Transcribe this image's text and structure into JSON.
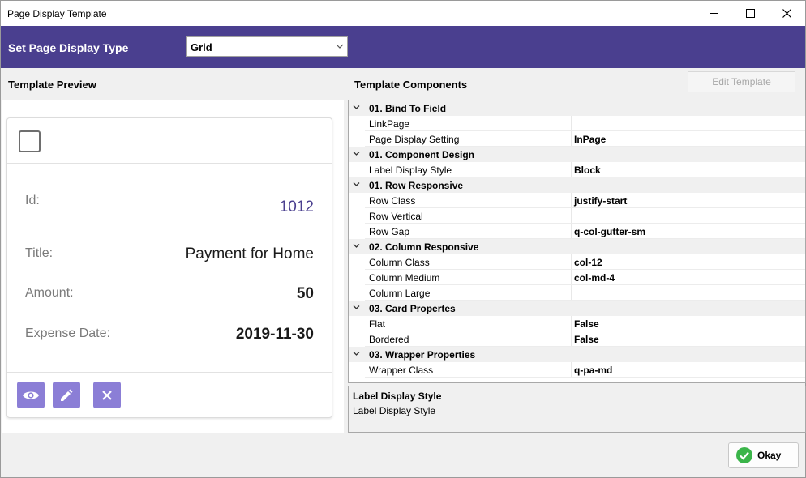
{
  "window": {
    "title": "Page Display Template"
  },
  "header": {
    "label": "Set Page Display Type",
    "select_value": "Grid"
  },
  "preview": {
    "title": "Template Preview",
    "fields": [
      {
        "label": "Id:",
        "value": "1012"
      },
      {
        "label": "Title:",
        "value": "Payment for Home"
      },
      {
        "label": "Amount:",
        "value": "50"
      },
      {
        "label": "Expense Date:",
        "value": "2019-11-30"
      }
    ],
    "actions": [
      "eye-icon",
      "pencil-icon",
      "close-icon"
    ]
  },
  "components": {
    "title": "Template Components",
    "edit_label": "Edit Template",
    "categories": [
      {
        "name": "01. Bind To Field",
        "props": [
          {
            "name": "LinkPage",
            "value": ""
          },
          {
            "name": "Page Display Setting",
            "value": "InPage"
          }
        ]
      },
      {
        "name": "01. Component Design",
        "props": [
          {
            "name": "Label Display Style",
            "value": "Block"
          }
        ]
      },
      {
        "name": "01. Row Responsive",
        "props": [
          {
            "name": "Row Class",
            "value": "justify-start"
          },
          {
            "name": "Row Vertical",
            "value": ""
          },
          {
            "name": "Row Gap",
            "value": "q-col-gutter-sm"
          }
        ]
      },
      {
        "name": "02. Column Responsive",
        "props": [
          {
            "name": "Column Class",
            "value": "col-12"
          },
          {
            "name": "Column Medium",
            "value": "col-md-4"
          },
          {
            "name": "Column Large",
            "value": ""
          }
        ]
      },
      {
        "name": "03. Card Propertes",
        "props": [
          {
            "name": "Flat",
            "value": "False"
          },
          {
            "name": "Bordered",
            "value": "False"
          }
        ]
      },
      {
        "name": "03. Wrapper Properties",
        "props": [
          {
            "name": "Wrapper Class",
            "value": "q-pa-md"
          }
        ]
      }
    ]
  },
  "description": {
    "title": "Label Display Style",
    "text": "Label Display Style"
  },
  "footer": {
    "okay_label": "Okay"
  },
  "colors": {
    "accent": "#4a3f8f",
    "button": "#8b7ed6",
    "ok_green": "#3bb54a"
  }
}
